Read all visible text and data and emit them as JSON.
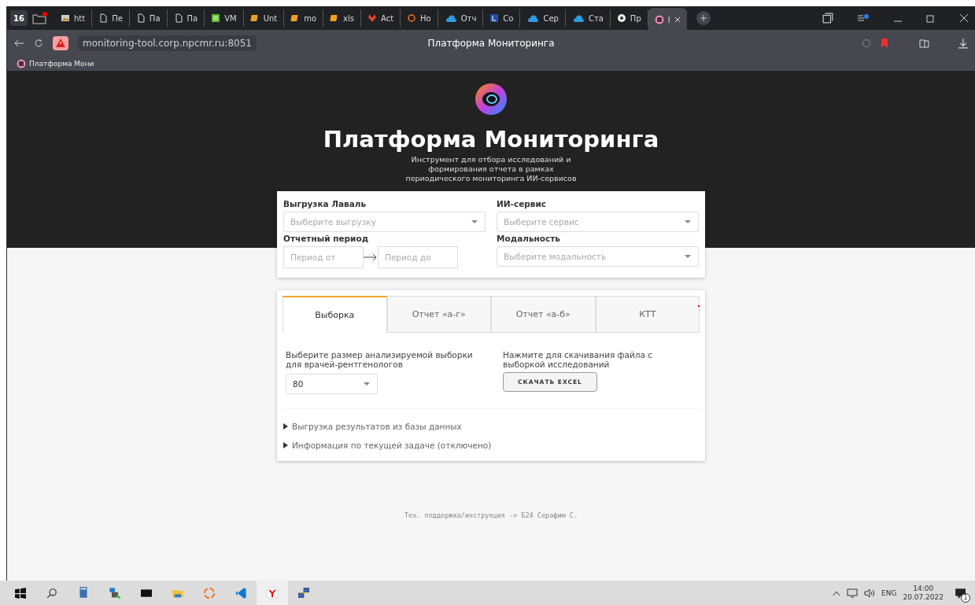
{
  "browser": {
    "tab_count": "16",
    "tabs": [
      {
        "label": "htt",
        "kind": "image",
        "selected": false
      },
      {
        "label": "Пе",
        "kind": "doc",
        "selected": false
      },
      {
        "label": "Па",
        "kind": "doc",
        "selected": false
      },
      {
        "label": "Па",
        "kind": "doc",
        "selected": false
      },
      {
        "label": "VM",
        "kind": "sheet",
        "selected": false
      },
      {
        "label": "Unt",
        "kind": "note",
        "selected": false
      },
      {
        "label": "mo",
        "kind": "note",
        "selected": false
      },
      {
        "label": "xls",
        "kind": "note",
        "selected": false
      },
      {
        "label": "Act",
        "kind": "fox",
        "selected": false
      },
      {
        "label": "Ho",
        "kind": "ring",
        "selected": false
      },
      {
        "label": "Отч",
        "kind": "b24",
        "selected": false
      },
      {
        "label": "Co",
        "kind": "letter",
        "selected": false
      },
      {
        "label": "Сер",
        "kind": "b24",
        "selected": false
      },
      {
        "label": "Ста",
        "kind": "b24",
        "selected": false
      },
      {
        "label": "Пр",
        "kind": "e",
        "selected": false
      },
      {
        "label": "I",
        "kind": "app",
        "selected": true
      }
    ],
    "address": "monitoring-tool.corp.npcmr.ru:8051",
    "page_title": "Платформа Мониторинга",
    "bookmarks": [
      {
        "label": "Платформа Мони"
      }
    ]
  },
  "header": {
    "title": "Платформа Мониторинга",
    "subtitle": "Инструмент для отбора исследований и формирования отчета в рамках периодического мониторинга ИИ-сервисов"
  },
  "filters": [
    {
      "label": "Выгрузка Лаваль",
      "kind": "select",
      "placeholder": "Выберите выгрузку"
    },
    {
      "label": "ИИ-сервис",
      "kind": "select",
      "placeholder": "Выберите сервис"
    },
    {
      "label": "Отчетный период",
      "kind": "range",
      "from_placeholder": "Период от",
      "to_placeholder": "Период до"
    },
    {
      "label": "Модальность",
      "kind": "select",
      "placeholder": "Выберите модальность"
    }
  ],
  "tabs": [
    {
      "label": "Выборка",
      "selected": true
    },
    {
      "label": "Отчет «а-г»",
      "selected": false
    },
    {
      "label": "Отчет «а-б»",
      "selected": false
    },
    {
      "label": "КТТ",
      "selected": false
    }
  ],
  "sample": {
    "prompt": "Выберите размер анализируемой выборки для врачей-рентгенологов",
    "value": "80"
  },
  "download": {
    "prompt": "Нажмите для скачивания файла с выборкой исследований",
    "button": "СКАЧАТЬ EXCEL"
  },
  "sections": [
    {
      "label": "Выгрузка результатов из базы данных",
      "expanded": false
    },
    {
      "label": "Информация по текущей задаче (отключено)",
      "expanded": false
    }
  ],
  "footer": "Тех. поддержка/инструкция -> Б24 Серафим С.",
  "taskbar": {
    "apps": [
      {
        "kind": "start",
        "selected": false
      },
      {
        "kind": "search",
        "selected": false
      },
      {
        "kind": "calculator",
        "selected": false
      },
      {
        "kind": "lock",
        "selected": false
      },
      {
        "kind": "terminal",
        "selected": false
      },
      {
        "kind": "folder",
        "selected": false
      },
      {
        "kind": "ring",
        "selected": false
      },
      {
        "kind": "code",
        "selected": false
      },
      {
        "kind": "yandex",
        "selected": true
      },
      {
        "kind": "network",
        "selected": false
      }
    ],
    "language": "ENG",
    "time": "14:00",
    "date": "20.07.2022",
    "notifications": "1"
  }
}
